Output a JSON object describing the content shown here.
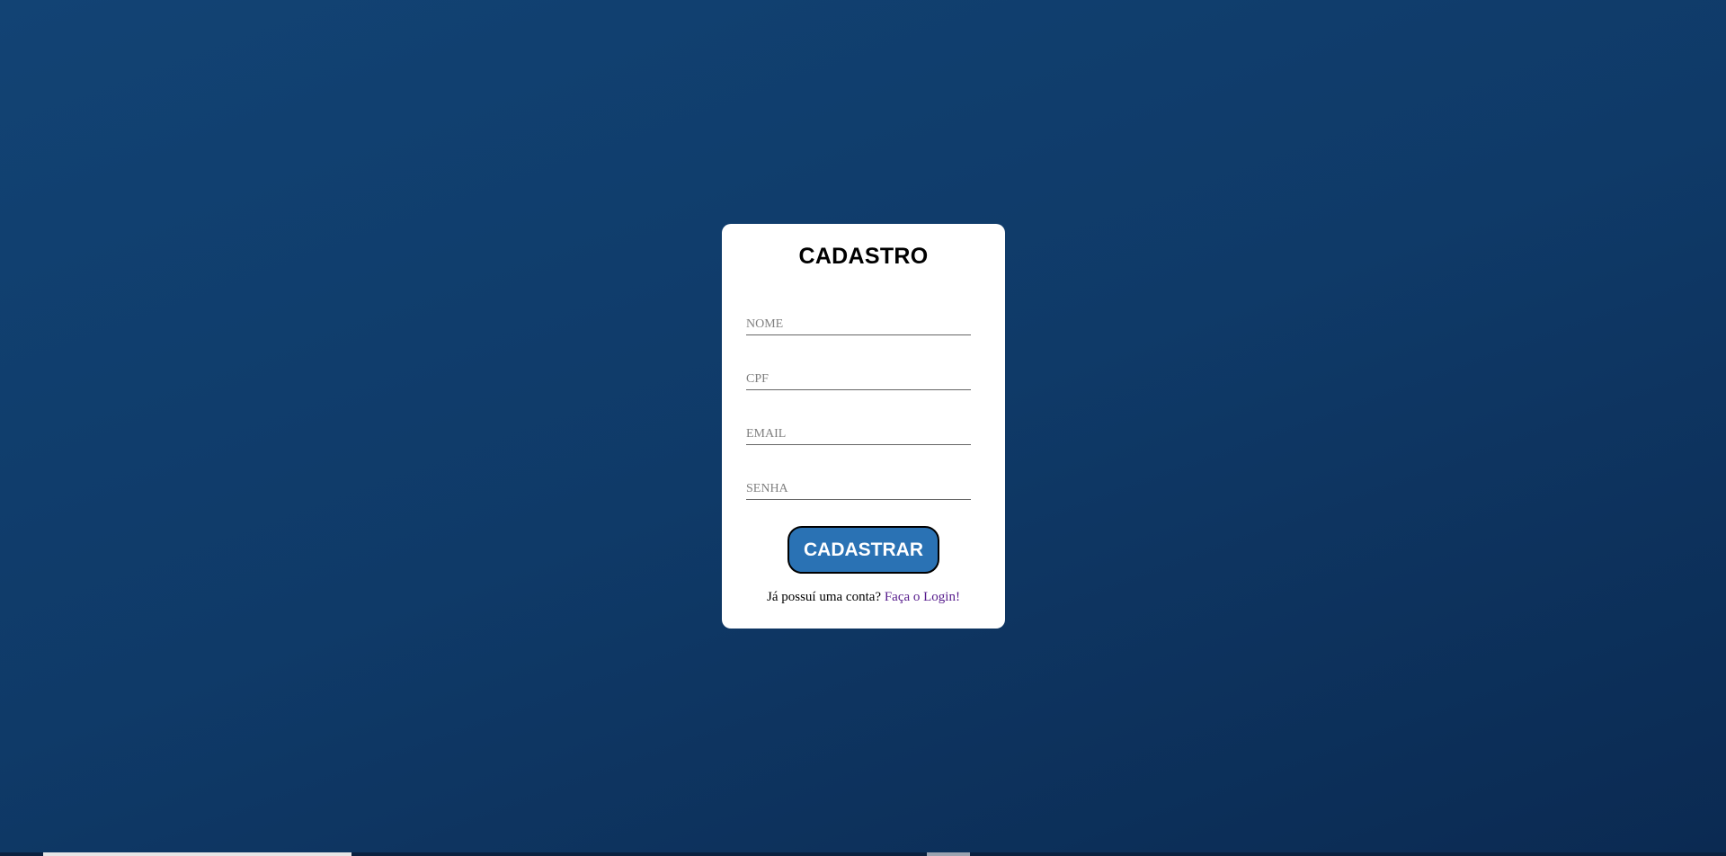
{
  "form": {
    "title": "CADASTRO",
    "fields": {
      "nome": {
        "placeholder": "NOME",
        "value": ""
      },
      "cpf": {
        "placeholder": "CPF",
        "value": ""
      },
      "email": {
        "placeholder": "EMAIL",
        "value": ""
      },
      "senha": {
        "placeholder": "SENHA",
        "value": ""
      }
    },
    "submit_label": "CADASTRAR",
    "footer": {
      "prompt": "Já possuí uma conta?",
      "link_label": "Faça o Login!"
    }
  },
  "colors": {
    "background_top": "#124374",
    "background_bottom": "#0b2a52",
    "card": "#ffffff",
    "button": "#2a72b4",
    "link": "#551a8b"
  }
}
